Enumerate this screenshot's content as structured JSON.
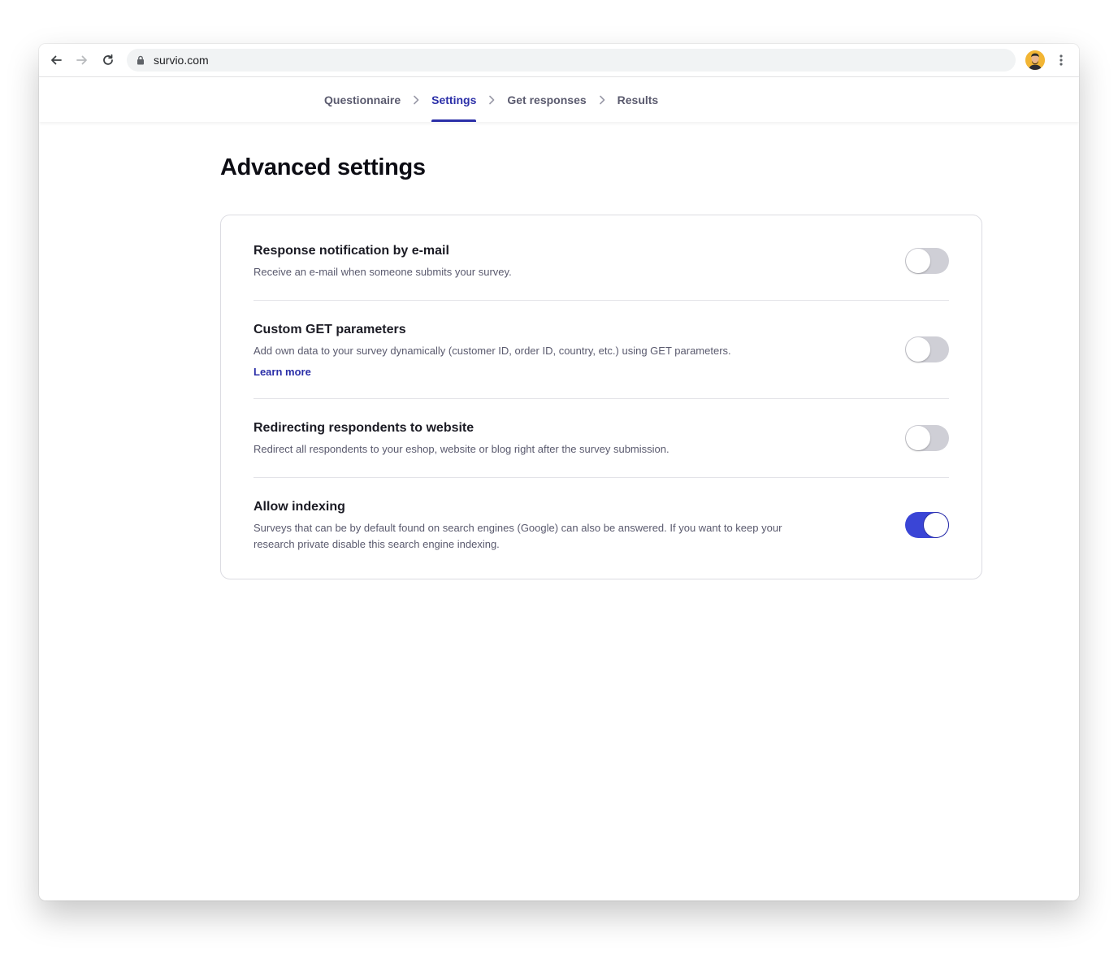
{
  "browser": {
    "url": "survio.com"
  },
  "steps": [
    {
      "label": "Questionnaire",
      "active": false
    },
    {
      "label": "Settings",
      "active": true
    },
    {
      "label": "Get responses",
      "active": false
    },
    {
      "label": "Results",
      "active": false
    }
  ],
  "page": {
    "title": "Advanced settings"
  },
  "settings": [
    {
      "title": "Response notification by e-mail",
      "description": "Receive an e-mail when someone submits your survey.",
      "enabled": false
    },
    {
      "title": "Custom GET parameters",
      "description": "Add own data to your survey dynamically (customer ID, order ID, country, etc.) using GET parameters.",
      "link": "Learn more",
      "enabled": false
    },
    {
      "title": "Redirecting respondents to website",
      "description": "Redirect all respondents to your eshop, website or blog right after the survey submission.",
      "enabled": false
    },
    {
      "title": "Allow indexing",
      "description": "Surveys that can be by default found on search engines (Google) can also be answered. If you want to keep your research private disable this search engine indexing.",
      "enabled": true
    }
  ],
  "colors": {
    "accent": "#2b2fa8",
    "toggle_on": "#3a45d6",
    "toggle_off": "#cfcfd6"
  },
  "icons": [
    "back-arrow-icon",
    "forward-arrow-icon",
    "reload-icon",
    "lock-icon",
    "avatar",
    "kebab-menu-icon",
    "chevron-right-icon"
  ]
}
